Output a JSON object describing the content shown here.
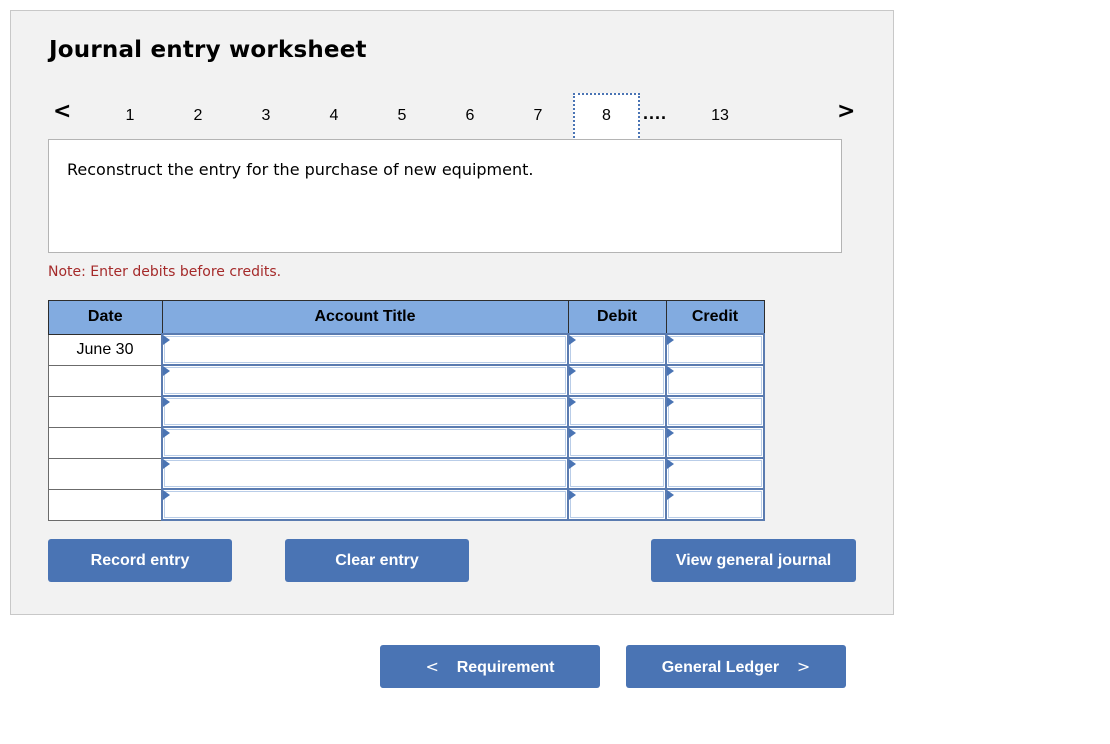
{
  "worksheet": {
    "title": "Journal entry worksheet",
    "nav": {
      "prev_icon": "chevron-left-icon",
      "next_icon": "chevron-right-icon",
      "prev_glyph": "<",
      "next_glyph": ">",
      "pages": [
        "1",
        "2",
        "3",
        "4",
        "5",
        "6",
        "7"
      ],
      "current": "8",
      "ellipsis": "....",
      "last": "13"
    },
    "description": "Reconstruct the entry for the purchase of new equipment.",
    "note": "Note: Enter debits before credits.",
    "table": {
      "headers": {
        "date": "Date",
        "account": "Account Title",
        "debit": "Debit",
        "credit": "Credit"
      },
      "rows": [
        {
          "date": "June 30",
          "account": "",
          "debit": "",
          "credit": ""
        },
        {
          "date": "",
          "account": "",
          "debit": "",
          "credit": ""
        },
        {
          "date": "",
          "account": "",
          "debit": "",
          "credit": ""
        },
        {
          "date": "",
          "account": "",
          "debit": "",
          "credit": ""
        },
        {
          "date": "",
          "account": "",
          "debit": "",
          "credit": ""
        },
        {
          "date": "",
          "account": "",
          "debit": "",
          "credit": ""
        }
      ]
    },
    "buttons": {
      "record": "Record entry",
      "clear": "Clear entry",
      "view_journal": "View general journal"
    }
  },
  "footer_nav": {
    "prev_label": "Requirement",
    "prev_glyph": "<",
    "next_label": "General Ledger",
    "next_glyph": ">"
  },
  "colors": {
    "accent": "#4a74b4",
    "header_bg": "#82abe0",
    "note": "#a52a2a",
    "panel_bg": "#f2f2f2"
  }
}
